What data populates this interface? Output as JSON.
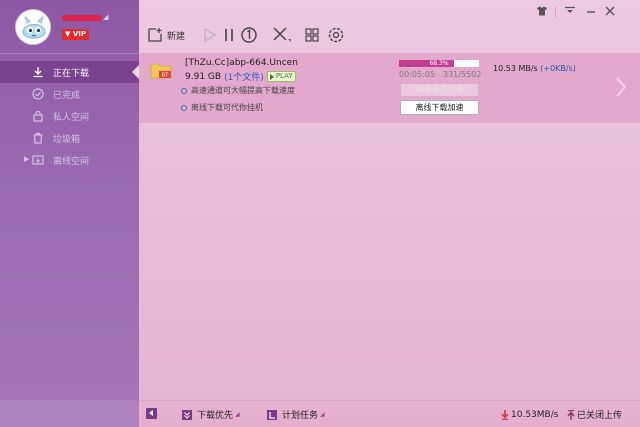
{
  "user": {
    "vip_label": "VIP",
    "caret": "◢"
  },
  "sidebar": {
    "items": [
      {
        "label": "正在下载",
        "icon": "download-icon",
        "active": true
      },
      {
        "label": "已完成",
        "icon": "check-circle-icon",
        "active": false
      },
      {
        "label": "私人空间",
        "icon": "lock-icon",
        "active": false
      },
      {
        "label": "垃圾箱",
        "icon": "trash-icon",
        "active": false
      },
      {
        "label": "离线空间",
        "icon": "cloud-folder-icon",
        "active": false,
        "expandable": true
      }
    ]
  },
  "toolbar": {
    "new_label": "新建",
    "buttons": [
      "plus-file-icon",
      "play-icon",
      "pause-icon",
      "clock-icon",
      "delete-icon",
      "grid-icon",
      "settings-icon"
    ]
  },
  "window_controls": [
    "skin-icon",
    "menu-icon",
    "minimize-icon",
    "close-icon"
  ],
  "task": {
    "name": "[ThZu.Cc]abp-664.Uncen",
    "size": "9.91 GB",
    "files": "(1个文件)",
    "play_label": "PLAY",
    "file_badge": "BT",
    "progress_text": "68.3%",
    "progress": 0.683,
    "elapsed": "00:05:05",
    "count": "331/5502",
    "speed": "10.53  MB/s",
    "speed_extra": "(+0KB/s)",
    "hint1": "高速通道可大幅提高下载速度",
    "hint2": "离线下载可代你挂机",
    "btn_high_speed": "高速通道加速",
    "btn_offline": "离线下载加速"
  },
  "bottom": {
    "priority_label": "下载优先",
    "schedule_label": "计划任务",
    "speed": "10.53MB/s",
    "upload": "已关闭上传"
  },
  "colors": {
    "accent": "#c33d93",
    "sidebar": "#9463a8",
    "link": "#2a57b5"
  }
}
